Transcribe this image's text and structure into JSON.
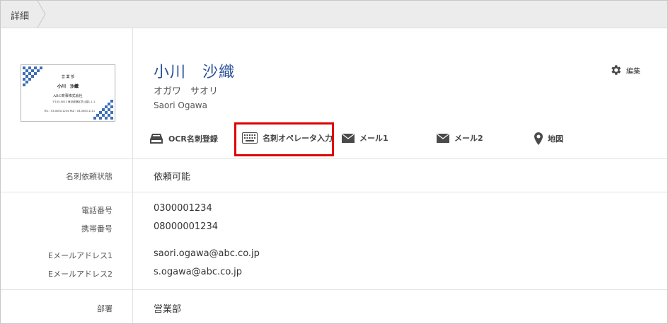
{
  "breadcrumb": {
    "label": "詳細"
  },
  "business_card": {
    "dept": "営 業 部",
    "name": "小川　沙織",
    "company": "ABC商事株式会社",
    "address": "〒105-0011 東京都港区芝公園1-1-1",
    "phone_line": "TEL : 03-0000-1234  FAX : 03-0000-1111"
  },
  "profile": {
    "name_jp": "小川　沙織",
    "name_kana": "オガワ　サオリ",
    "name_en": "Saori Ogawa"
  },
  "edit": {
    "label": "編集"
  },
  "actions": {
    "ocr": "OCR名刺登録",
    "operator": "名刺オペレータ入力",
    "mail1": "メール1",
    "mail2": "メール2",
    "map": "地図"
  },
  "fields": {
    "status_label": "名刺依頼状態",
    "status_value": "依頼可能",
    "phone_label": "電話番号",
    "phone_value": "0300001234",
    "mobile_label": "携帯番号",
    "mobile_value": "08000001234",
    "email1_label": "Eメールアドレス1",
    "email1_value": "saori.ogawa@abc.co.jp",
    "email2_label": "Eメールアドレス2",
    "email2_value": "s.ogawa@abc.co.jp",
    "dept_label": "部署",
    "dept_value": "営業部"
  },
  "colors": {
    "accent_name": "#2a4f9a",
    "highlight_border": "#e00000",
    "card_pattern": "#3d6fb6"
  }
}
